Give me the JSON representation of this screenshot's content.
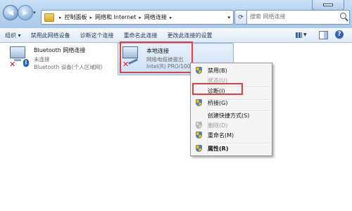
{
  "address": {
    "breadcrumbs": [
      "控制面板",
      "网络和 Internet",
      "网络连接"
    ],
    "search_placeholder": "搜索 网络连接"
  },
  "toolbar": {
    "items": [
      "组织 ▾",
      "禁用此网络设备",
      "诊断这个连接",
      "重命名此连接",
      "更改此连接的设置"
    ]
  },
  "connections": [
    {
      "name": "Bluetooth 网络连接",
      "status": "未连接",
      "device": "Bluetooth 设备(个人区域网)"
    },
    {
      "name": "本地连接",
      "status": "网络电缆被拔出",
      "device": "Intel(R) PRO/1000"
    }
  ],
  "context_menu": {
    "items": [
      {
        "label": "禁用(B)"
      },
      {
        "label": "状态(U)"
      },
      {
        "label": "诊断(I)"
      },
      {
        "label": "桥接(G)"
      },
      {
        "label": "创建快捷方式(S)"
      },
      {
        "label": "删除(D)"
      },
      {
        "label": "重命名(M)"
      },
      {
        "label": "属性(R)"
      }
    ]
  },
  "colors": {
    "highlight": "#e53c3c",
    "link": "#1e395b"
  }
}
